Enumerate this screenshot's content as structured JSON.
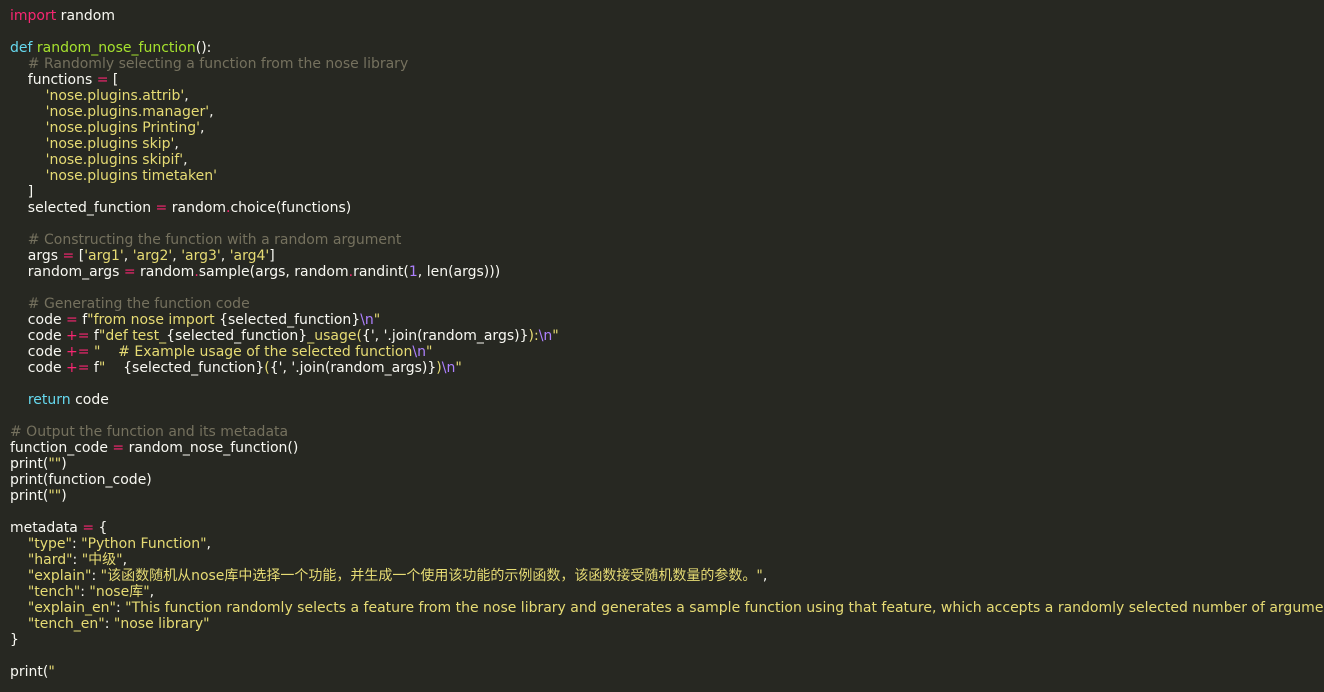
{
  "theme": {
    "background": "#272822",
    "text": "#f8f8f2",
    "keyword": "#f92672",
    "builtin": "#66d9ef",
    "function_name": "#a6e22e",
    "comment": "#75715e",
    "string": "#e6db74",
    "number": "#ae81ff"
  },
  "lines": [
    [
      {
        "t": "import",
        "c": "kw"
      },
      {
        "t": " random",
        "c": "pl"
      }
    ],
    [],
    [
      {
        "t": "def",
        "c": "kw2"
      },
      {
        "t": " ",
        "c": "pl"
      },
      {
        "t": "random_nose_function",
        "c": "fn"
      },
      {
        "t": "():",
        "c": "pl"
      }
    ],
    [
      {
        "t": "    # Randomly selecting a function from the nose library",
        "c": "cm"
      }
    ],
    [
      {
        "t": "    functions ",
        "c": "pl"
      },
      {
        "t": "=",
        "c": "op"
      },
      {
        "t": " [",
        "c": "pl"
      }
    ],
    [
      {
        "t": "        'nose.plugins.attrib'",
        "c": "str"
      },
      {
        "t": ",",
        "c": "pl"
      }
    ],
    [
      {
        "t": "        'nose.plugins.manager'",
        "c": "str"
      },
      {
        "t": ",",
        "c": "pl"
      }
    ],
    [
      {
        "t": "        'nose.plugins Printing'",
        "c": "str"
      },
      {
        "t": ",",
        "c": "pl"
      }
    ],
    [
      {
        "t": "        'nose.plugins skip'",
        "c": "str"
      },
      {
        "t": ",",
        "c": "pl"
      }
    ],
    [
      {
        "t": "        'nose.plugins skipif'",
        "c": "str"
      },
      {
        "t": ",",
        "c": "pl"
      }
    ],
    [
      {
        "t": "        'nose.plugins timetaken'",
        "c": "str"
      }
    ],
    [
      {
        "t": "    ]",
        "c": "pl"
      }
    ],
    [
      {
        "t": "    selected_function ",
        "c": "pl"
      },
      {
        "t": "=",
        "c": "op"
      },
      {
        "t": " random",
        "c": "pl"
      },
      {
        "t": ".",
        "c": "op"
      },
      {
        "t": "choice(functions)",
        "c": "pl"
      }
    ],
    [],
    [
      {
        "t": "    # Constructing the function with a random argument",
        "c": "cm"
      }
    ],
    [
      {
        "t": "    args ",
        "c": "pl"
      },
      {
        "t": "=",
        "c": "op"
      },
      {
        "t": " [",
        "c": "pl"
      },
      {
        "t": "'arg1'",
        "c": "str"
      },
      {
        "t": ", ",
        "c": "pl"
      },
      {
        "t": "'arg2'",
        "c": "str"
      },
      {
        "t": ", ",
        "c": "pl"
      },
      {
        "t": "'arg3'",
        "c": "str"
      },
      {
        "t": ", ",
        "c": "pl"
      },
      {
        "t": "'arg4'",
        "c": "str"
      },
      {
        "t": "]",
        "c": "pl"
      }
    ],
    [
      {
        "t": "    random_args ",
        "c": "pl"
      },
      {
        "t": "=",
        "c": "op"
      },
      {
        "t": " random",
        "c": "pl"
      },
      {
        "t": ".",
        "c": "op"
      },
      {
        "t": "sample(args, random",
        "c": "pl"
      },
      {
        "t": ".",
        "c": "op"
      },
      {
        "t": "randint(",
        "c": "pl"
      },
      {
        "t": "1",
        "c": "num"
      },
      {
        "t": ", len(args)))",
        "c": "pl"
      }
    ],
    [],
    [
      {
        "t": "    # Generating the function code",
        "c": "cm"
      }
    ],
    [
      {
        "t": "    code ",
        "c": "pl"
      },
      {
        "t": "=",
        "c": "op"
      },
      {
        "t": " f",
        "c": "pl"
      },
      {
        "t": "\"from nose import ",
        "c": "str"
      },
      {
        "t": "{selected_function}",
        "c": "pl"
      },
      {
        "t": "\\n",
        "c": "num"
      },
      {
        "t": "\"",
        "c": "str"
      }
    ],
    [
      {
        "t": "    code ",
        "c": "pl"
      },
      {
        "t": "+=",
        "c": "op"
      },
      {
        "t": " f",
        "c": "pl"
      },
      {
        "t": "\"def test_",
        "c": "str"
      },
      {
        "t": "{selected_function}",
        "c": "pl"
      },
      {
        "t": "_usage(",
        "c": "str"
      },
      {
        "t": "{', '.join(random_args)}",
        "c": "pl"
      },
      {
        "t": "):",
        "c": "str"
      },
      {
        "t": "\\n",
        "c": "num"
      },
      {
        "t": "\"",
        "c": "str"
      }
    ],
    [
      {
        "t": "    code ",
        "c": "pl"
      },
      {
        "t": "+=",
        "c": "op"
      },
      {
        "t": " ",
        "c": "pl"
      },
      {
        "t": "\"    # Example usage of the selected function",
        "c": "str"
      },
      {
        "t": "\\n",
        "c": "num"
      },
      {
        "t": "\"",
        "c": "str"
      }
    ],
    [
      {
        "t": "    code ",
        "c": "pl"
      },
      {
        "t": "+=",
        "c": "op"
      },
      {
        "t": " f",
        "c": "pl"
      },
      {
        "t": "\"    ",
        "c": "str"
      },
      {
        "t": "{selected_function}",
        "c": "pl"
      },
      {
        "t": "(",
        "c": "str"
      },
      {
        "t": "{', '.join(random_args)}",
        "c": "pl"
      },
      {
        "t": ")",
        "c": "str"
      },
      {
        "t": "\\n",
        "c": "num"
      },
      {
        "t": "\"",
        "c": "str"
      }
    ],
    [],
    [
      {
        "t": "    ",
        "c": "pl"
      },
      {
        "t": "return",
        "c": "kw2"
      },
      {
        "t": " code",
        "c": "pl"
      }
    ],
    [],
    [
      {
        "t": "# Output the function and its metadata",
        "c": "cm"
      }
    ],
    [
      {
        "t": "function_code ",
        "c": "pl"
      },
      {
        "t": "=",
        "c": "op"
      },
      {
        "t": " random_nose_function()",
        "c": "pl"
      }
    ],
    [
      {
        "t": "print(",
        "c": "pl"
      },
      {
        "t": "\"\"",
        "c": "str"
      },
      {
        "t": ")",
        "c": "pl"
      }
    ],
    [
      {
        "t": "print(function_code)",
        "c": "pl"
      }
    ],
    [
      {
        "t": "print(",
        "c": "pl"
      },
      {
        "t": "\"\"",
        "c": "str"
      },
      {
        "t": ")",
        "c": "pl"
      }
    ],
    [],
    [
      {
        "t": "metadata ",
        "c": "pl"
      },
      {
        "t": "=",
        "c": "op"
      },
      {
        "t": " {",
        "c": "pl"
      }
    ],
    [
      {
        "t": "    ",
        "c": "pl"
      },
      {
        "t": "\"type\"",
        "c": "str"
      },
      {
        "t": ": ",
        "c": "pl"
      },
      {
        "t": "\"Python Function\"",
        "c": "str"
      },
      {
        "t": ",",
        "c": "pl"
      }
    ],
    [
      {
        "t": "    ",
        "c": "pl"
      },
      {
        "t": "\"hard\"",
        "c": "str"
      },
      {
        "t": ": ",
        "c": "pl"
      },
      {
        "t": "\"中级\"",
        "c": "str"
      },
      {
        "t": ",",
        "c": "pl"
      }
    ],
    [
      {
        "t": "    ",
        "c": "pl"
      },
      {
        "t": "\"explain\"",
        "c": "str"
      },
      {
        "t": ": ",
        "c": "pl"
      },
      {
        "t": "\"该函数随机从nose库中选择一个功能，并生成一个使用该功能的示例函数，该函数接受随机数量的参数。\"",
        "c": "str"
      },
      {
        "t": ",",
        "c": "pl"
      }
    ],
    [
      {
        "t": "    ",
        "c": "pl"
      },
      {
        "t": "\"tench\"",
        "c": "str"
      },
      {
        "t": ": ",
        "c": "pl"
      },
      {
        "t": "\"nose库\"",
        "c": "str"
      },
      {
        "t": ",",
        "c": "pl"
      }
    ],
    [
      {
        "t": "    ",
        "c": "pl"
      },
      {
        "t": "\"explain_en\"",
        "c": "str"
      },
      {
        "t": ": ",
        "c": "pl"
      },
      {
        "t": "\"This function randomly selects a feature from the nose library and generates a sample function using that feature, which accepts a randomly selected number of arguments.\"",
        "c": "str"
      },
      {
        "t": ",",
        "c": "pl"
      }
    ],
    [
      {
        "t": "    ",
        "c": "pl"
      },
      {
        "t": "\"tench_en\"",
        "c": "str"
      },
      {
        "t": ": ",
        "c": "pl"
      },
      {
        "t": "\"nose library\"",
        "c": "str"
      }
    ],
    [
      {
        "t": "}",
        "c": "pl"
      }
    ],
    [],
    [
      {
        "t": "print(",
        "c": "pl"
      },
      {
        "t": "\"",
        "c": "str"
      }
    ]
  ]
}
